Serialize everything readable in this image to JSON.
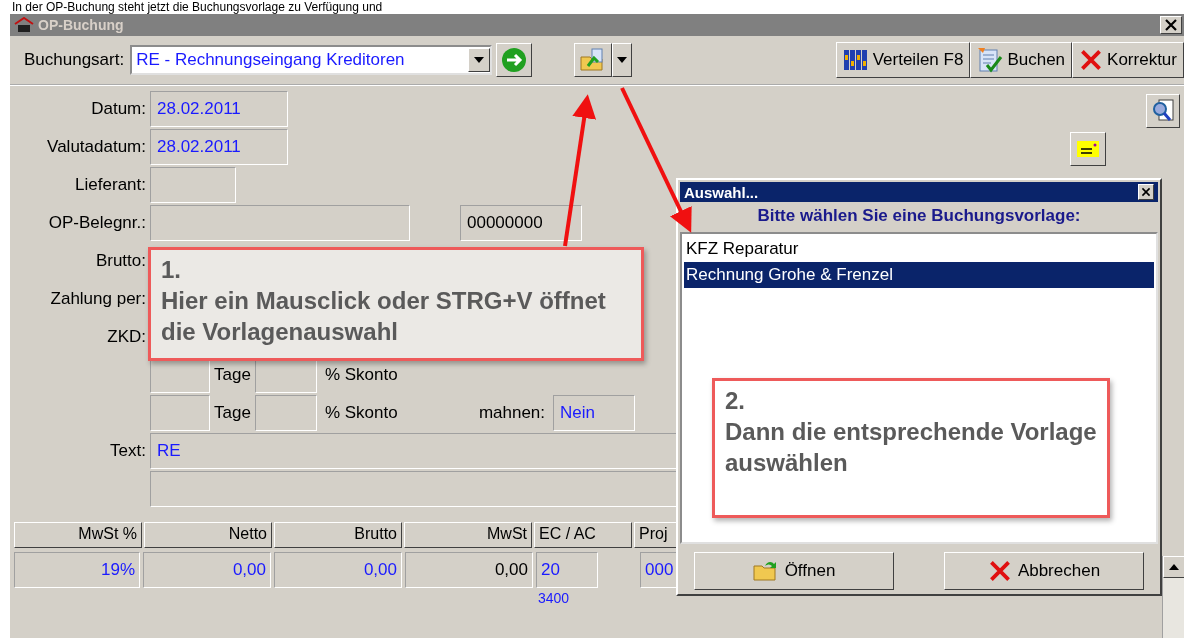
{
  "caption": "In der OP-Buchung steht jetzt die Buchungsvorlage zu Verfügung und",
  "window": {
    "title": "OP-Buchung"
  },
  "toolbar": {
    "label": "Buchungsart:",
    "value": "RE - Rechnungseingang Kreditoren",
    "buttons": [
      {
        "label": "Verteilen F8",
        "kind": "distribute"
      },
      {
        "label": "Buchen",
        "kind": "post"
      },
      {
        "label": "Korrektur",
        "kind": "cancel"
      }
    ]
  },
  "form": [
    {
      "kind": "date",
      "label": "Datum:",
      "value": "28.02.2011"
    },
    {
      "kind": "date",
      "label": "Valutadatum:",
      "value": "28.02.2011"
    },
    {
      "kind": "short",
      "label": "Lieferant:"
    },
    {
      "kind": "doc",
      "label": "OP-Belegnr.:",
      "number": "00000000"
    },
    {
      "kind": "label",
      "label": "Brutto:"
    },
    {
      "kind": "label",
      "label": "Zahlung per:"
    },
    {
      "kind": "label",
      "label": "ZKD:"
    },
    {
      "kind": "skonto",
      "days": "Tage",
      "percent": "% Skonto"
    },
    {
      "kind": "skonto",
      "days": "Tage",
      "percent": "% Skonto",
      "dun_label": "mahnen:",
      "dun_value": "Nein"
    },
    {
      "kind": "text",
      "label": "Text:",
      "value": "RE"
    },
    {
      "kind": "text"
    }
  ],
  "table": {
    "columns": [
      "MwSt %",
      "Netto",
      "Brutto",
      "MwSt",
      "EC / AC",
      "Proj"
    ],
    "row": [
      "19%",
      "0,00",
      "0,00",
      "0,00",
      "20",
      "000"
    ],
    "sub": "3400"
  },
  "dialog": {
    "title": "Auswahl...",
    "heading": "Bitte wählen Sie eine Buchungsvorlage:",
    "items": [
      {
        "label": "KFZ Reparatur",
        "selected": false
      },
      {
        "label": "Rechnung Grohe & Frenzel",
        "selected": true
      }
    ],
    "buttons": [
      {
        "label": "Öffnen",
        "kind": "open"
      },
      {
        "label": "Abbrechen",
        "kind": "cancel"
      }
    ]
  },
  "annotations": [
    {
      "number": "1.",
      "text": "Hier ein Mausclick oder STRG+V öffnet die Vorlagenauswahl"
    },
    {
      "number": "2.",
      "text": "Dann die entsprechende Vorlage auswählen"
    }
  ]
}
